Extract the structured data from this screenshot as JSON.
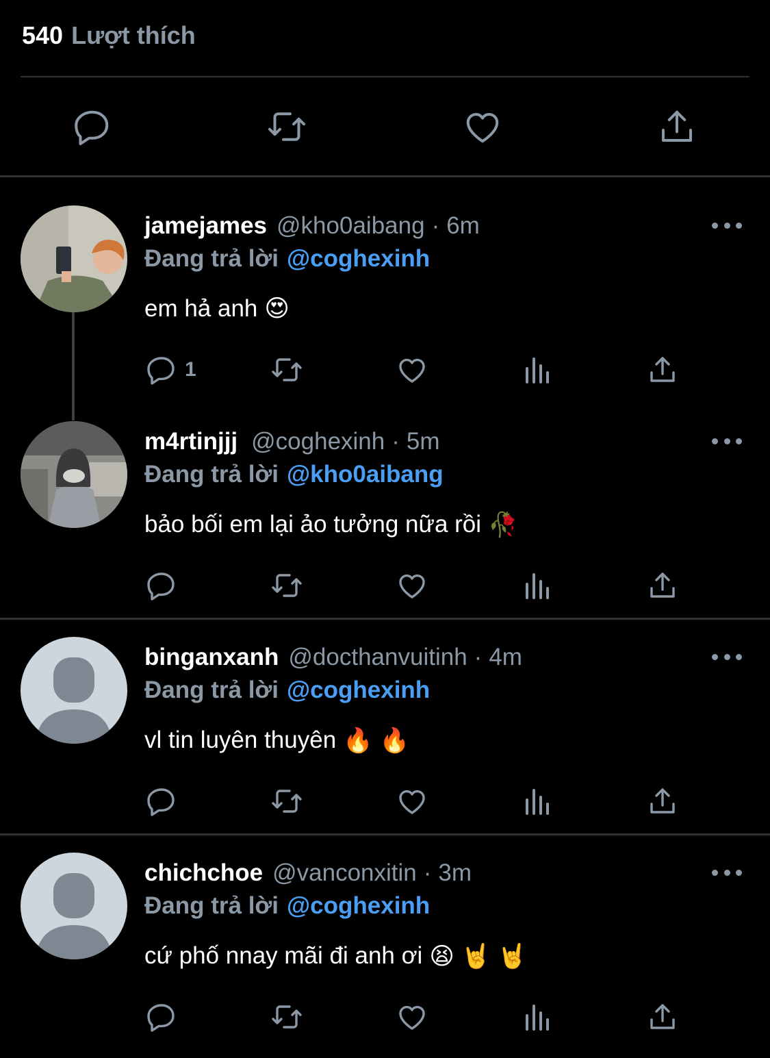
{
  "likes": {
    "count": "540",
    "label": "Lượt thích"
  },
  "action_bar": [
    "reply-icon",
    "retweet-icon",
    "like-icon",
    "share-icon"
  ],
  "replies": [
    {
      "name": "jamejames",
      "handle": "@kho0aibang",
      "time": "6m",
      "replying_label": "Đang trả lời",
      "replying_to": "@coghexinh",
      "text": "em hả anh",
      "emojis": "😍",
      "reply_count": "1",
      "avatar": "photo"
    },
    {
      "name": "m4rtinjjj",
      "handle": "@coghexinh",
      "time": "5m",
      "replying_label": "Đang trả lời",
      "replying_to": "@kho0aibang",
      "text": "bảo bối em lại ảo tưởng nữa rồi",
      "emojis": "🥀",
      "reply_count": "",
      "avatar": "photo"
    },
    {
      "name": "binganxanh",
      "handle": "@docthanvuitinh",
      "time": "4m",
      "replying_label": "Đang trả lời",
      "replying_to": "@coghexinh",
      "text": "vl tin luyên thuyên",
      "emojis": "🔥 🔥",
      "reply_count": "",
      "avatar": "default"
    },
    {
      "name": "chichchoe",
      "handle": "@vanconxitin",
      "time": "3m",
      "replying_label": "Đang trả lời",
      "replying_to": "@coghexinh",
      "text": "cứ phố nnay mãi đi anh ơi",
      "emojis": "😫 🤘 🤘",
      "reply_count": "",
      "avatar": "default"
    }
  ],
  "colors": {
    "background": "#000000",
    "muted": "#8b98a5",
    "link": "#4a9ff5",
    "divider": "#2f3336"
  }
}
